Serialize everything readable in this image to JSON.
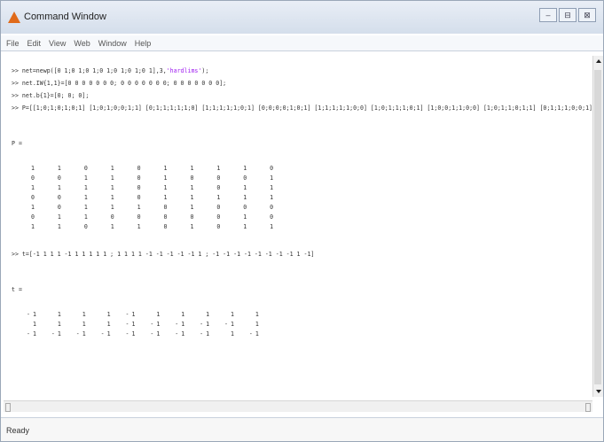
{
  "window": {
    "title": "Command Window",
    "controls": [
      "–",
      "⊟",
      "⊠"
    ]
  },
  "menu": [
    "File",
    "Edit",
    "View",
    "Web",
    "Window",
    "Help"
  ],
  "console": {
    "line1_prefix": ">> net=newp([0 1;0 1;0 1;0 1;0 1;0 1;0 1],3,",
    "line1_string": "'hardlims'",
    "line1_suffix": ");",
    "line2": ">> net.IW{1,1}=[0 0 0 0 0 0 0; 0 0 0 0 0 0 0; 0 0 0 0 0 0 0];",
    "line3": ">> net.b{1}=[0; 0; 0];",
    "line4": ">> P=[[1;0;1;0;1;0;1] [1;0;1;0;0;1;1] [0;1;1;1;1;1;0] [1;1;1;1;1;0;1] [0;0;0;0;1;0;1] [1;1;1;1;1;0;0] [1;0;1;1;1;0;1] [1;0;0;1;1;0;0] [1;0;1;1;0;1;1] [0;1;1;1;0;0;1]]",
    "p_label": "P =",
    "P_rows": [
      "1  1  0  1  0  1  1  1  1  0",
      "0  0  1  1  0  1  0  0  0  1",
      "1  1  1  1  0  1  1  0  1  1",
      "0  0  1  1  0  1  1  1  1  1",
      "1  0  1  1  1  0  1  0  0  0",
      "0  1  1  0  0  0  0  0  1  0",
      "1  1  0  1  1  0  1  0  1  1"
    ],
    "line5": ">> t=[-1 1 1 1 -1 1 1 1 1 1 ; 1 1 1 1 -1 -1 -1 -1 -1 1 ; -1 -1 -1 -1 -1 -1 -1 -1 1 -1]",
    "t_label": "t =",
    "t_rows": [
      "-1   1   1   1  -1   1   1   1   1   1",
      " 1   1   1   1  -1  -1  -1  -1  -1   1",
      "-1  -1  -1  -1  -1  -1  -1  -1   1  -1"
    ]
  },
  "status": "Ready"
}
